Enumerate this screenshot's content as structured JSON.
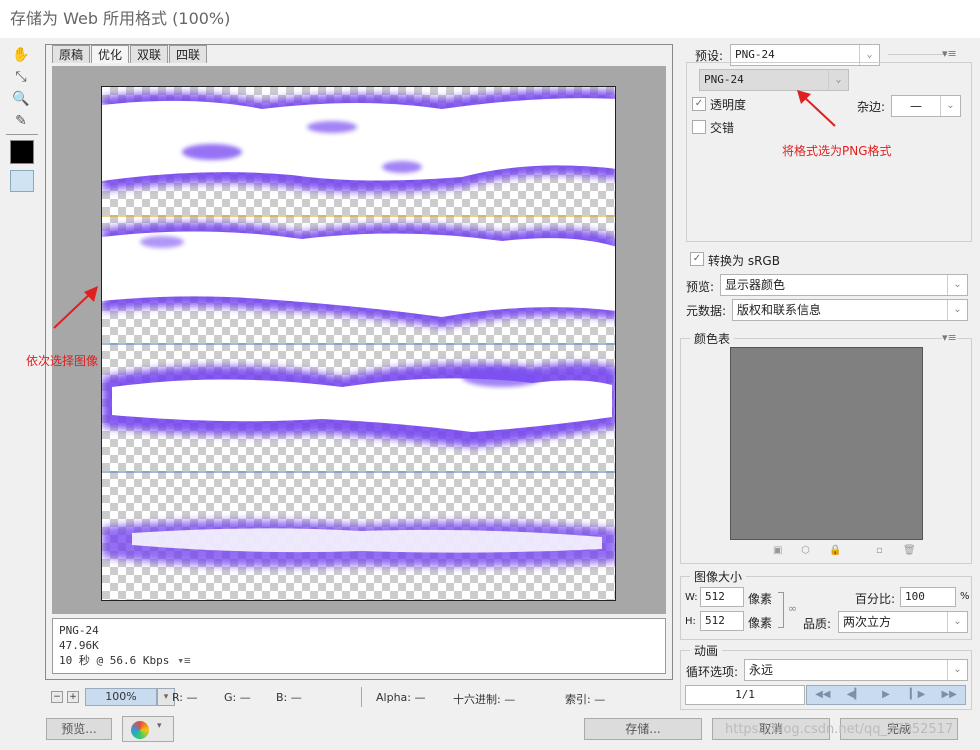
{
  "window": {
    "title": "存储为 Web 所用格式 (100%)"
  },
  "tools": [
    "hand-icon",
    "slice-select-icon",
    "zoom-icon",
    "eyedropper-icon"
  ],
  "tabs": [
    "原稿",
    "优化",
    "双联",
    "四联"
  ],
  "image_info": {
    "format": "PNG-24",
    "size": "47.96K",
    "time": "10 秒 @ 56.6 Kbps"
  },
  "statusbar": {
    "zoom": "100%",
    "r": "R: —",
    "g": "G: —",
    "b": "B: —",
    "alpha": "Alpha: —",
    "hex": "十六进制: —",
    "index": "索引: —"
  },
  "bottom_buttons": {
    "preview": "预览...",
    "save": "存储...",
    "cancel": "取消",
    "done": "完成"
  },
  "watermark": "https://blog.csdn.net/qq_37052517",
  "settings": {
    "preset_label": "预设:",
    "preset_value": "PNG-24",
    "format_value": "PNG-24",
    "transparency_label": "透明度",
    "matte_label": "杂边:",
    "matte_value": "—",
    "interlaced_label": "交错",
    "annotation_format": "将格式选为PNG格式",
    "convert_srgb_label": "转换为 sRGB",
    "preview_label": "预览:",
    "preview_value": "显示器颜色",
    "metadata_label": "元数据:",
    "metadata_value": "版权和联系信息"
  },
  "color_table": {
    "title": "颜色表"
  },
  "image_size": {
    "title": "图像大小",
    "w_label": "W:",
    "w_value": "512",
    "w_unit": "像素",
    "h_label": "H:",
    "h_value": "512",
    "h_unit": "像素",
    "percent_label": "百分比:",
    "percent_value": "100",
    "percent_unit": "%",
    "quality_label": "品质:",
    "quality_value": "两次立方"
  },
  "animation": {
    "title": "动画",
    "loop_label": "循环选项:",
    "loop_value": "永远",
    "frame": "1/1"
  },
  "annotation_left": "依次选择图像",
  "colors": {
    "accent_annotation": "#e02020",
    "flame": "#6f3cf0"
  }
}
